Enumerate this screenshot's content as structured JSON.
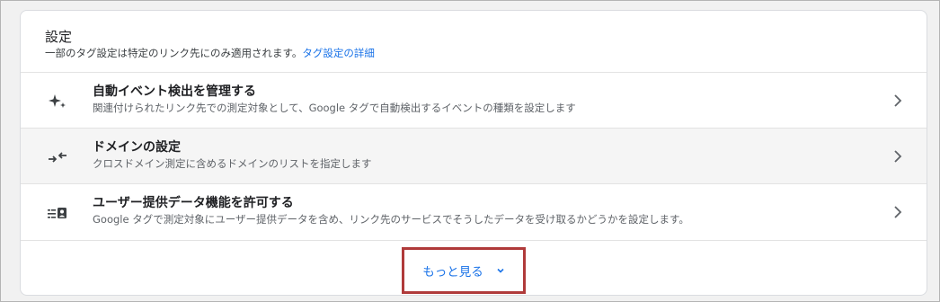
{
  "card": {
    "title": "設定",
    "description": "一部のタグ設定は特定のリンク先にのみ適用されます。",
    "details_link": "タグ設定の詳細"
  },
  "rows": [
    {
      "icon": "sparkle-icon",
      "title": "自動イベント検出を管理する",
      "subtitle": "関連付けられたリンク先での測定対象として、Google タグで自動検出するイベントの種類を設定します"
    },
    {
      "icon": "cross-domain-arrows-icon",
      "title": "ドメインの設定",
      "subtitle": "クロスドメイン測定に含めるドメインのリストを指定します"
    },
    {
      "icon": "user-data-icon",
      "title": "ユーザー提供データ機能を許可する",
      "subtitle": "Google タグで測定対象にユーザー提供データを含め、リンク先のサービスでそうしたデータを受け取るかどうかを設定します。"
    }
  ],
  "show_more": {
    "label": "もっと見る"
  },
  "colors": {
    "link": "#1a73e8",
    "highlight_border": "#b03a3a"
  }
}
